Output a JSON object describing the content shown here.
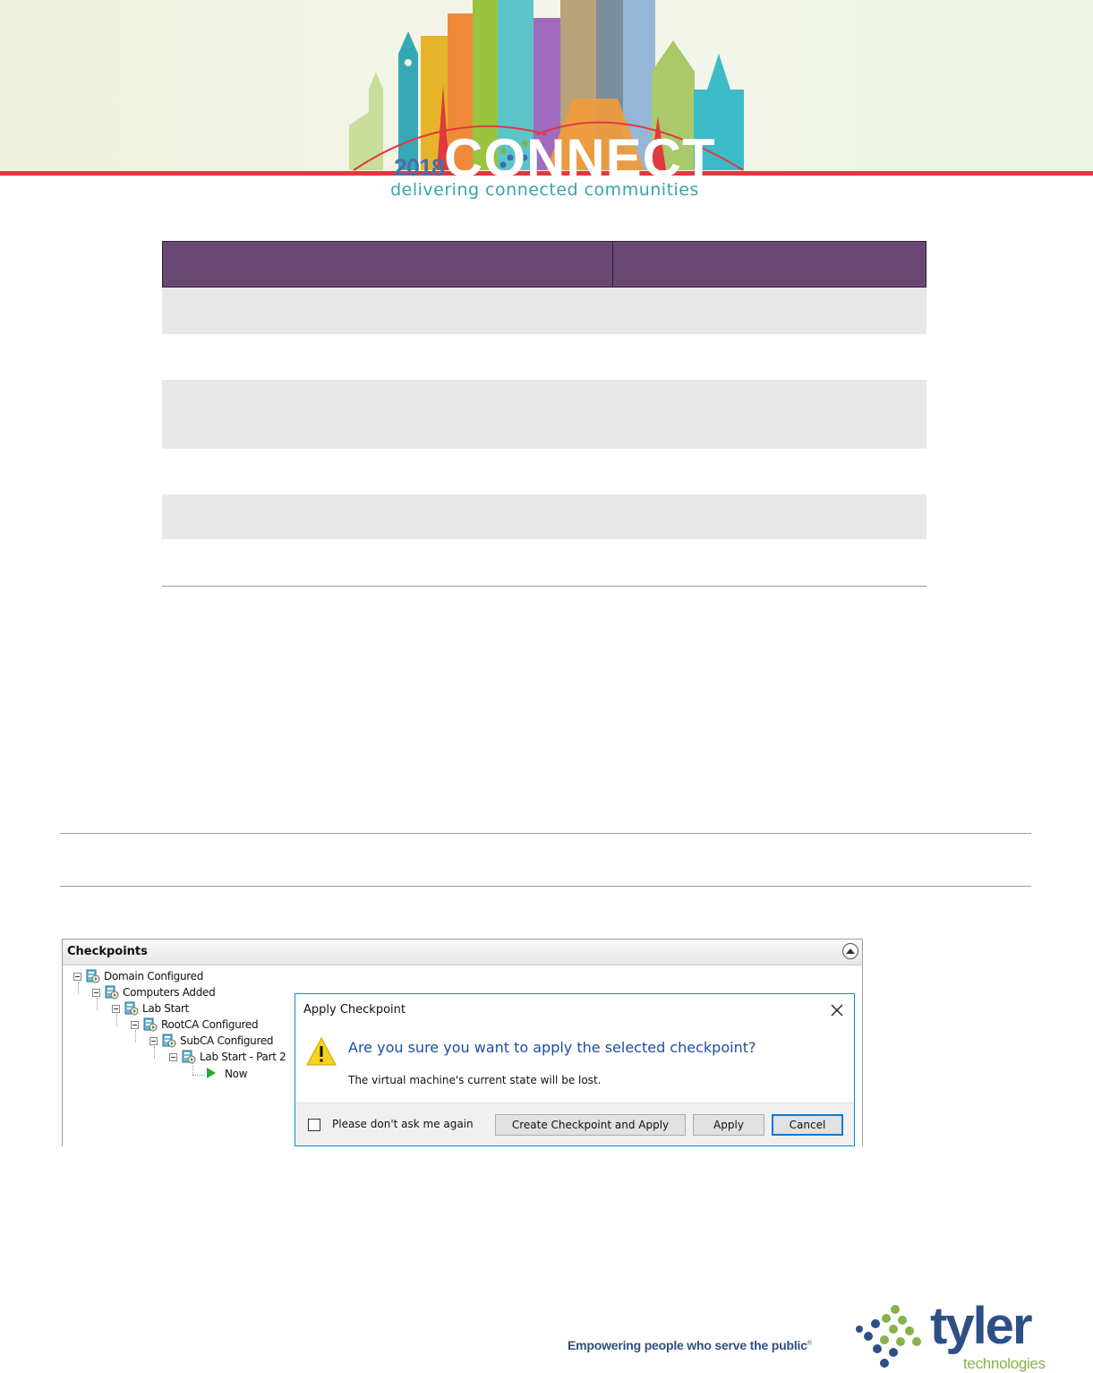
{
  "banner": {
    "year": "2018",
    "wordmark": "CONNECT",
    "tagline": "delivering connected communities"
  },
  "checkpoints": {
    "title": "Checkpoints",
    "tree": [
      {
        "label": "Domain Configured",
        "icon": "vm-checkpoint-icon"
      },
      {
        "label": "Computers Added",
        "icon": "vm-checkpoint-icon"
      },
      {
        "label": "Lab Start",
        "icon": "vm-checkpoint-icon"
      },
      {
        "label": "RootCA Configured",
        "icon": "vm-checkpoint-icon"
      },
      {
        "label": "SubCA Configured",
        "icon": "vm-checkpoint-icon"
      },
      {
        "label": "Lab Start - Part 2",
        "icon": "vm-checkpoint-icon"
      },
      {
        "label": "Now",
        "icon": "play-icon"
      }
    ]
  },
  "dialog": {
    "title": "Apply Checkpoint",
    "question": "Are you sure you want to apply the selected checkpoint?",
    "message": "The virtual machine's current state will be lost.",
    "checkbox_label": "Please don't ask me again",
    "checkbox_checked": false,
    "buttons": {
      "create_apply": "Create Checkpoint and Apply",
      "apply": "Apply",
      "cancel": "Cancel"
    }
  },
  "footer": {
    "tagline": "Empowering people who serve the public",
    "brand": "tyler",
    "brand_sub": "technologies"
  },
  "colors": {
    "table_header": "#6a4874",
    "table_shade": "#e8e8e8",
    "dialog_accent": "#1883d7",
    "question_text": "#1c4ea6",
    "tyler_blue": "#2d4f86",
    "tyler_green": "#87b14a"
  }
}
